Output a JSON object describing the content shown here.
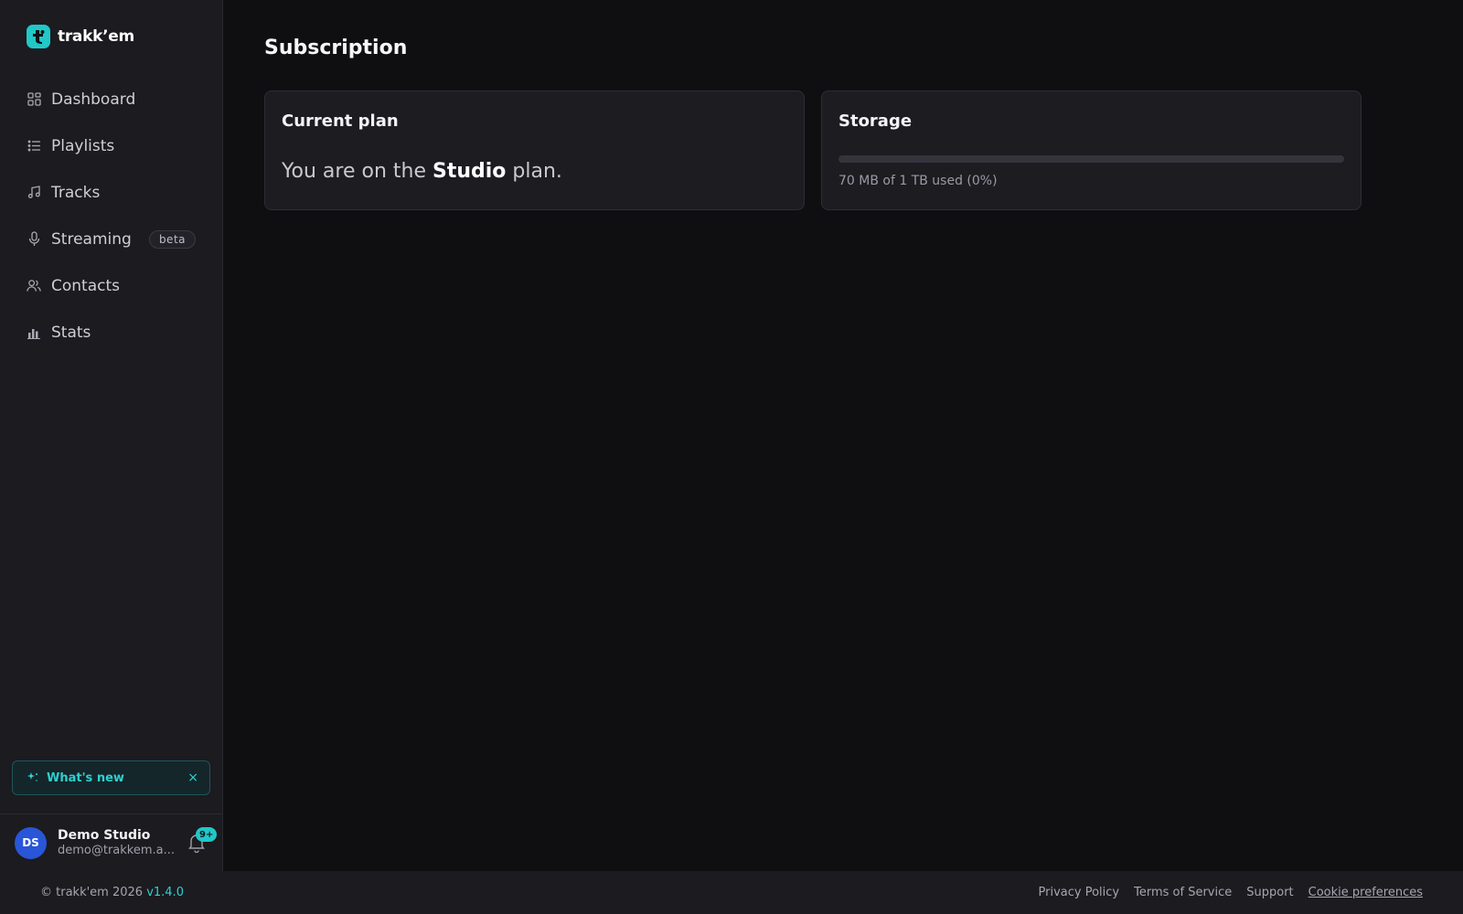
{
  "brand": {
    "name": "trakk’em",
    "accent": "#22c7c7"
  },
  "sidebar": {
    "items": [
      {
        "label": "Dashboard",
        "icon": "grid-icon"
      },
      {
        "label": "Playlists",
        "icon": "list-icon"
      },
      {
        "label": "Tracks",
        "icon": "music-note-icon"
      },
      {
        "label": "Streaming",
        "icon": "microphone-icon",
        "badge": "beta"
      },
      {
        "label": "Contacts",
        "icon": "users-icon"
      },
      {
        "label": "Stats",
        "icon": "bar-chart-icon"
      }
    ],
    "whats_new": {
      "label": "What's new",
      "close": "×",
      "icon": "sparkle-icon"
    },
    "user": {
      "initials": "DS",
      "name": "Demo Studio",
      "email": "demo@trakkem.a...",
      "notifications": "9+",
      "avatar_color": "#2956d8"
    }
  },
  "main": {
    "title": "Subscription",
    "plan_card": {
      "title": "Current plan",
      "text_prefix": "You are on the ",
      "plan_name": "Studio",
      "text_suffix": " plan."
    },
    "storage_card": {
      "title": "Storage",
      "used_fraction": 0,
      "usage_text": "70 MB of 1 TB used (0%)"
    }
  },
  "footer": {
    "copyright": "© trakk'em 2026 ",
    "version": "v1.4.0",
    "links": [
      "Privacy Policy",
      "Terms of Service",
      "Support",
      "Cookie preferences"
    ]
  }
}
